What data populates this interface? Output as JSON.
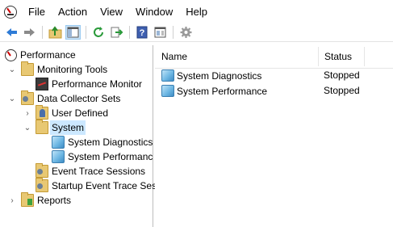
{
  "menu": {
    "items": [
      "File",
      "Action",
      "View",
      "Window",
      "Help"
    ]
  },
  "toolbar": {
    "icons": [
      "back-arrow",
      "forward-arrow",
      "up-folder",
      "show-hide-console-tree",
      "refresh",
      "export-list",
      "help",
      "properties",
      "gear"
    ]
  },
  "tree": {
    "root": "Performance",
    "monitoring_tools": "Monitoring Tools",
    "performance_monitor": "Performance Monitor",
    "data_collector_sets": "Data Collector Sets",
    "user_defined": "User Defined",
    "system": "System",
    "system_diagnostics": "System Diagnostics",
    "system_performance": "System Performanc",
    "event_trace_sessions": "Event Trace Sessions",
    "startup_event_trace": "Startup Event Trace Ses",
    "reports": "Reports"
  },
  "list": {
    "columns": {
      "name": "Name",
      "status": "Status"
    },
    "rows": [
      {
        "name": "System Diagnostics",
        "status": "Stopped"
      },
      {
        "name": "System Performance",
        "status": "Stopped"
      }
    ]
  },
  "colors": {
    "selection": "#cce8ff",
    "toolbar_active": "#cce4f7",
    "folder": "#e8c873",
    "divider": "#bdbdbd"
  }
}
